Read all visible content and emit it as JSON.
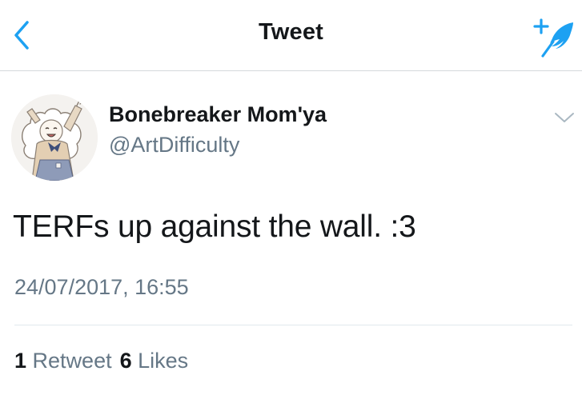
{
  "header": {
    "title": "Tweet",
    "back_icon": "chevron-left-icon",
    "compose_icon": "compose-tweet-icon",
    "accent_color": "#1da1f2"
  },
  "tweet": {
    "author": {
      "name": "Bonebreaker Mom'ya",
      "handle": "@ArtDifficulty",
      "avatar_icon": "avatar-drawing"
    },
    "text": "TERFs up against the wall. :3",
    "timestamp": "24/07/2017, 16:55",
    "menu_icon": "chevron-down-icon",
    "stats": {
      "retweets": {
        "count": "1",
        "label": "Retweet"
      },
      "likes": {
        "count": "6",
        "label": "Likes"
      }
    }
  },
  "colors": {
    "primary_text": "#14171a",
    "secondary_text": "#657786",
    "divider": "#e1e8ed"
  }
}
